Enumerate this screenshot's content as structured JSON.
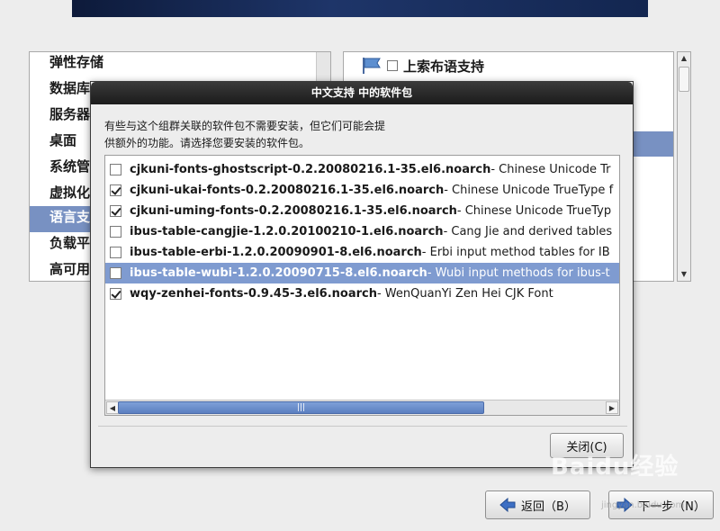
{
  "left_list": {
    "items": [
      {
        "label": "弹性存储",
        "selected": false
      },
      {
        "label": "数据库",
        "selected": false
      },
      {
        "label": "服务器",
        "selected": false
      },
      {
        "label": "桌面",
        "selected": false
      },
      {
        "label": "系统管",
        "selected": false
      },
      {
        "label": "虚拟化",
        "selected": false
      },
      {
        "label": "语言支",
        "selected": true
      },
      {
        "label": "负载平",
        "selected": false
      },
      {
        "label": "高可用",
        "selected": false
      }
    ]
  },
  "right_list": {
    "first_item": {
      "label": "上索布语支持",
      "checked": false,
      "icon": "flag-icon"
    }
  },
  "dialog": {
    "title": "中文支持 中的软件包",
    "description_line1": "有些与这个组群关联的软件包不需要安装，但它们可能会提",
    "description_line2": "供额外的功能。请选择您要安装的软件包。",
    "packages": [
      {
        "name": "cjkuni-fonts-ghostscript-0.2.20080216.1-35.el6.noarch",
        "desc": " - Chinese Unicode Tr",
        "checked": false,
        "selected": false
      },
      {
        "name": "cjkuni-ukai-fonts-0.2.20080216.1-35.el6.noarch",
        "desc": " - Chinese Unicode TrueType f",
        "checked": true,
        "selected": false
      },
      {
        "name": "cjkuni-uming-fonts-0.2.20080216.1-35.el6.noarch",
        "desc": " - Chinese Unicode TrueTyp",
        "checked": true,
        "selected": false
      },
      {
        "name": "ibus-table-cangjie-1.2.0.20100210-1.el6.noarch",
        "desc": " - Cang Jie and derived tables",
        "checked": false,
        "selected": false
      },
      {
        "name": "ibus-table-erbi-1.2.0.20090901-8.el6.noarch",
        "desc": " - Erbi input method tables for IB",
        "checked": false,
        "selected": false
      },
      {
        "name": "ibus-table-wubi-1.2.0.20090715-8.el6.noarch",
        "desc": " - Wubi input methods for ibus-t",
        "checked": false,
        "selected": true
      },
      {
        "name": "wqy-zenhei-fonts-0.9.45-3.el6.noarch",
        "desc": " - WenQuanYi Zen Hei CJK Font",
        "checked": true,
        "selected": false
      }
    ],
    "hscroll_grip": "|||",
    "close_label": "关闭(C)"
  },
  "footer": {
    "back_label": "返回（B）",
    "next_label": "下一步（N）"
  },
  "watermark": {
    "logo": "Baidu经验",
    "url": "jingyan.baidu.com"
  },
  "colors": {
    "selection": "#7891c2",
    "dialog_title_bg": "#1b1b1b",
    "scroll_thumb": "#5b7fc0"
  }
}
